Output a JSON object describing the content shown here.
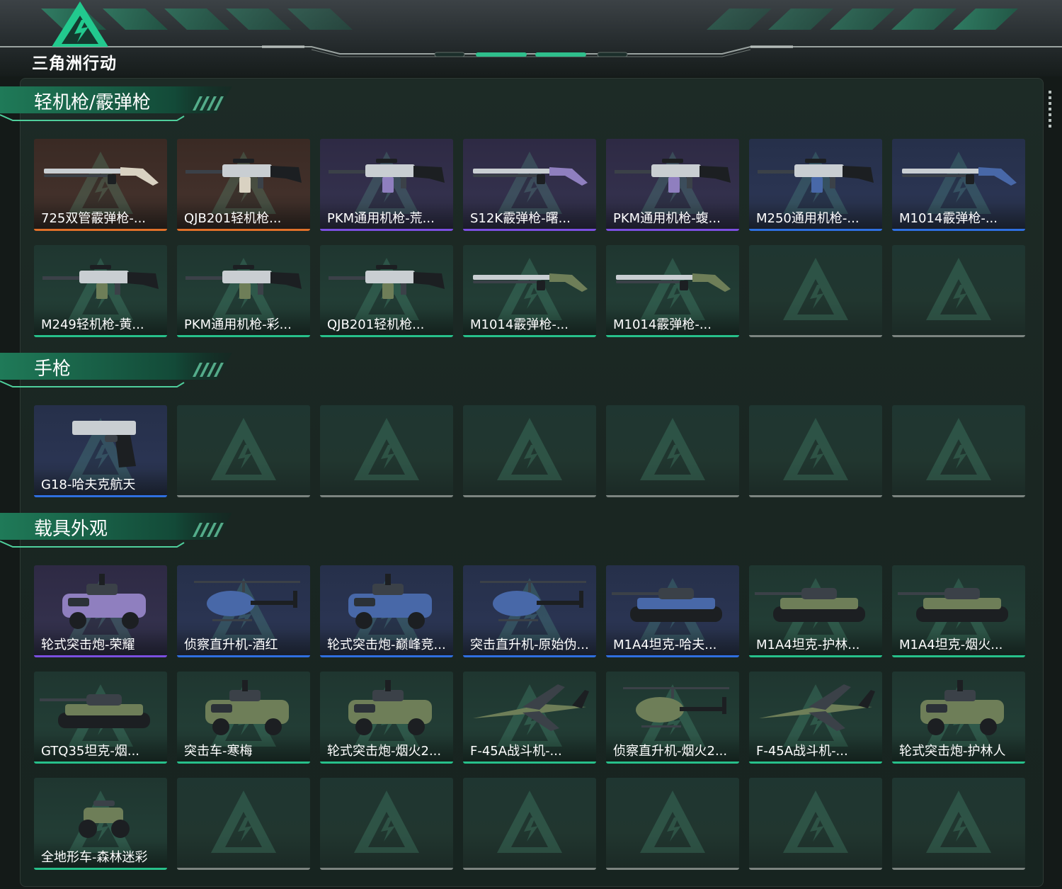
{
  "app": {
    "logo_text": "三角洲行动"
  },
  "colors": {
    "orange": "#e0702a",
    "purple": "#7b4fe0",
    "blue": "#2f6fe0",
    "green": "#27c08a",
    "empty": "#7c8480"
  },
  "sections": [
    {
      "title": "轻机枪/霰弹枪",
      "items": [
        {
          "label": "725双管霰弹枪-...",
          "rarity": "orange",
          "icon": "shotgun-icon"
        },
        {
          "label": "QJB201轻机枪...",
          "rarity": "orange",
          "icon": "machine-gun-icon"
        },
        {
          "label": "PKM通用机枪-荒...",
          "rarity": "purple",
          "icon": "machine-gun-icon"
        },
        {
          "label": "S12K霰弹枪-曙...",
          "rarity": "purple",
          "icon": "shotgun-icon"
        },
        {
          "label": "PKM通用机枪-蝮...",
          "rarity": "purple",
          "icon": "machine-gun-icon"
        },
        {
          "label": "M250通用机枪-...",
          "rarity": "blue",
          "icon": "machine-gun-icon"
        },
        {
          "label": "M1014霰弹枪-...",
          "rarity": "blue",
          "icon": "shotgun-icon"
        },
        {
          "label": "M249轻机枪-黄...",
          "rarity": "green",
          "icon": "machine-gun-icon"
        },
        {
          "label": "PKM通用机枪-彩...",
          "rarity": "green",
          "icon": "machine-gun-icon"
        },
        {
          "label": "QJB201轻机枪...",
          "rarity": "green",
          "icon": "machine-gun-icon"
        },
        {
          "label": "M1014霰弹枪-...",
          "rarity": "green",
          "icon": "shotgun-icon"
        },
        {
          "label": "M1014霰弹枪-...",
          "rarity": "green",
          "icon": "shotgun-icon"
        },
        {
          "label": "",
          "rarity": "empty",
          "icon": "empty-slot-icon"
        },
        {
          "label": "",
          "rarity": "empty",
          "icon": "empty-slot-icon"
        }
      ]
    },
    {
      "title": "手枪",
      "items": [
        {
          "label": "G18-哈夫克航天",
          "rarity": "blue",
          "icon": "pistol-icon"
        },
        {
          "label": "",
          "rarity": "empty",
          "icon": "empty-slot-icon"
        },
        {
          "label": "",
          "rarity": "empty",
          "icon": "empty-slot-icon"
        },
        {
          "label": "",
          "rarity": "empty",
          "icon": "empty-slot-icon"
        },
        {
          "label": "",
          "rarity": "empty",
          "icon": "empty-slot-icon"
        },
        {
          "label": "",
          "rarity": "empty",
          "icon": "empty-slot-icon"
        },
        {
          "label": "",
          "rarity": "empty",
          "icon": "empty-slot-icon"
        }
      ]
    },
    {
      "title": "载具外观",
      "items": [
        {
          "label": "轮式突击炮-荣耀",
          "rarity": "purple",
          "icon": "armored-car-icon"
        },
        {
          "label": "侦察直升机-酒红",
          "rarity": "blue",
          "icon": "helicopter-icon"
        },
        {
          "label": "轮式突击炮-巅峰竞...",
          "rarity": "blue",
          "icon": "armored-car-icon"
        },
        {
          "label": "突击直升机-原始伪...",
          "rarity": "blue",
          "icon": "helicopter-icon"
        },
        {
          "label": "M1A4坦克-哈夫...",
          "rarity": "blue",
          "icon": "tank-icon"
        },
        {
          "label": "M1A4坦克-护林...",
          "rarity": "green",
          "icon": "tank-icon"
        },
        {
          "label": "M1A4坦克-烟火...",
          "rarity": "green",
          "icon": "tank-icon"
        },
        {
          "label": "GTQ35坦克-烟...",
          "rarity": "green",
          "icon": "tank-icon"
        },
        {
          "label": "突击车-寒梅",
          "rarity": "green",
          "icon": "armored-car-icon"
        },
        {
          "label": "轮式突击炮-烟火2...",
          "rarity": "green",
          "icon": "armored-car-icon"
        },
        {
          "label": "F-45A战斗机-...",
          "rarity": "green",
          "icon": "fighter-jet-icon"
        },
        {
          "label": "侦察直升机-烟火2...",
          "rarity": "green",
          "icon": "helicopter-icon"
        },
        {
          "label": "F-45A战斗机-...",
          "rarity": "green",
          "icon": "fighter-jet-icon"
        },
        {
          "label": "轮式突击炮-护林人",
          "rarity": "green",
          "icon": "armored-car-icon"
        },
        {
          "label": "全地形车-森林迷彩",
          "rarity": "green",
          "icon": "atv-icon"
        },
        {
          "label": "",
          "rarity": "empty",
          "icon": "empty-slot-icon"
        },
        {
          "label": "",
          "rarity": "empty",
          "icon": "empty-slot-icon"
        },
        {
          "label": "",
          "rarity": "empty",
          "icon": "empty-slot-icon"
        },
        {
          "label": "",
          "rarity": "empty",
          "icon": "empty-slot-icon"
        },
        {
          "label": "",
          "rarity": "empty",
          "icon": "empty-slot-icon"
        },
        {
          "label": "",
          "rarity": "empty",
          "icon": "empty-slot-icon"
        }
      ]
    }
  ]
}
